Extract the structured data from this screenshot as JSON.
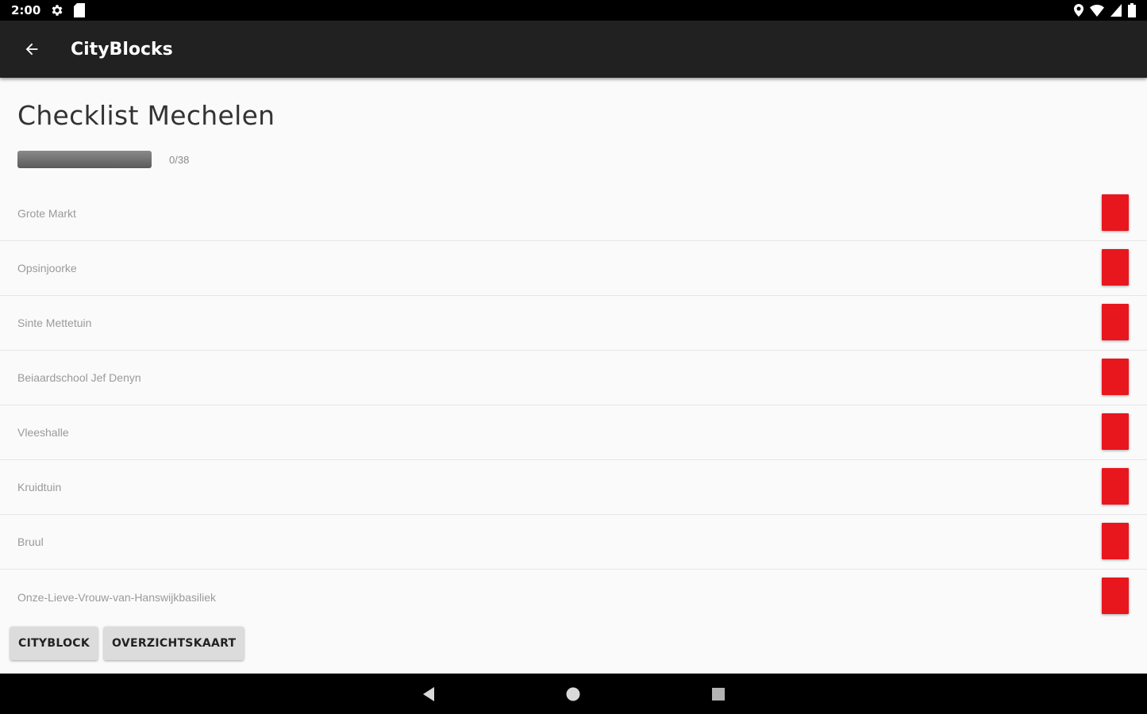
{
  "status_bar": {
    "time": "2:00",
    "icons": [
      "settings-icon",
      "sd-card-icon",
      "location-icon",
      "wifi-icon",
      "signal-icon",
      "battery-icon"
    ]
  },
  "app_bar": {
    "title": "CityBlocks",
    "back_icon": "arrow-back-icon"
  },
  "page": {
    "title": "Checklist Mechelen",
    "progress": {
      "done": 0,
      "total": 38,
      "label": "0/38"
    }
  },
  "checklist": {
    "items": [
      {
        "label": "Grote Markt",
        "checked": false
      },
      {
        "label": "Opsinjoorke",
        "checked": false
      },
      {
        "label": "Sinte Mettetuin",
        "checked": false
      },
      {
        "label": "Beiaardschool Jef Denyn",
        "checked": false
      },
      {
        "label": "Vleeshalle",
        "checked": false
      },
      {
        "label": "Kruidtuin",
        "checked": false
      },
      {
        "label": "Bruul",
        "checked": false
      },
      {
        "label": "Onze-Lieve-Vrouw-van-Hanswijkbasiliek",
        "checked": false
      }
    ],
    "unchecked_color": "#e8161d"
  },
  "buttons": {
    "cityblock": "CITYBLOCK",
    "overview_map": "OVERZICHTSKAART"
  },
  "nav_bar": {
    "icons": [
      "nav-back-icon",
      "nav-home-icon",
      "nav-recents-icon"
    ]
  }
}
